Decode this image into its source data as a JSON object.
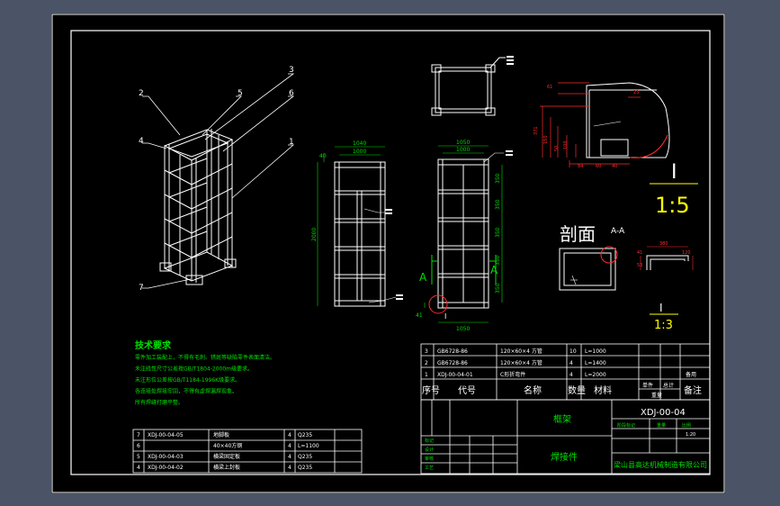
{
  "colors": {
    "background": "#4a5466",
    "sheet": "#000000",
    "line": "#ffffff",
    "dim": "#00e000",
    "note": "#00e000",
    "title_text": "#00e000",
    "detail": "#ff2a2a",
    "yellow": "#ffff00"
  },
  "balloons": [
    "2",
    "5",
    "3",
    "6",
    "4",
    "1",
    "7"
  ],
  "front_view": {
    "dim_top1": "1040",
    "dim_top2": "1000",
    "dim_height": "2000",
    "dim_left": "40"
  },
  "side_view": {
    "dim_top1": "1050",
    "dim_top2": "1000",
    "dim_bottom": "1050",
    "dims_right": [
      "350",
      "350",
      "350",
      "350",
      "350"
    ],
    "section_mark_left": "A",
    "section_mark_right": "A",
    "detail_mark": "I",
    "dim_left": "41"
  },
  "detail_view": {
    "label_roman": "I",
    "label_scale": "1:5",
    "dims": [
      "61",
      "23",
      "371",
      "150",
      "50",
      "100",
      "84",
      "60",
      "40"
    ]
  },
  "section_view": {
    "title": "剖面",
    "mark": "A-A",
    "dims": [
      "380",
      "120",
      "41",
      "53"
    ],
    "label_roman": "I",
    "label_scale": "1:3"
  },
  "tech_req": {
    "title": "技术要求",
    "lines": [
      "零件加工装配上，不得有毛刺、锈斑等缺陷零件表面清洁。",
      "未注线性尺寸公差按GB/T1804-2000m级要求。",
      "未注形位公差按GB/T1184-1996K级要求。",
      "各连接处焊接牢固，不得有虚焊漏焊现象。",
      "所有焊缝打磨平整。"
    ]
  },
  "parts_left": [
    {
      "no": "7",
      "code": "XDJ-00-04-05",
      "name": "地脚板",
      "qty": "4",
      "mat": "Q235"
    },
    {
      "no": "6",
      "code": "",
      "name": "40×40方钢",
      "qty": "4",
      "mat": "L=1100"
    },
    {
      "no": "5",
      "code": "XDJ-00-04-03",
      "name": "横梁固定板",
      "qty": "4",
      "mat": "Q235"
    },
    {
      "no": "4",
      "code": "XDJ-00-04-02",
      "name": "横梁上封板",
      "qty": "4",
      "mat": "Q235"
    }
  ],
  "parts_right": [
    {
      "no": "3",
      "code": "GB6728-86",
      "name": "120×60×4 方管",
      "qty": "10",
      "mat": "L=1000",
      "note": ""
    },
    {
      "no": "2",
      "code": "GB6728-86",
      "name": "120×60×4 方管",
      "qty": "4",
      "mat": "L=1400",
      "note": ""
    },
    {
      "no": "1",
      "code": "XDJ-00-04-01",
      "name": "C形折弯件",
      "qty": "4",
      "mat": "L=2000",
      "note": "备用"
    }
  ],
  "parts_header": {
    "no": "序号",
    "code": "代号",
    "name": "名称",
    "qty": "数量",
    "mat": "材料",
    "unit": "单件",
    "total": "总计",
    "weight": "重量",
    "note": "备注"
  },
  "title_block": {
    "part_name": "框架",
    "drawing_no": "XDJ-00-04",
    "type": "焊接件",
    "company": "梁山县高达机械制造有限公司",
    "stage": "阶段标记",
    "weight_label": "重量",
    "scale_label": "比例",
    "scale": "1:20",
    "rows": [
      "标记",
      "设计",
      "审核",
      "工艺"
    ]
  }
}
